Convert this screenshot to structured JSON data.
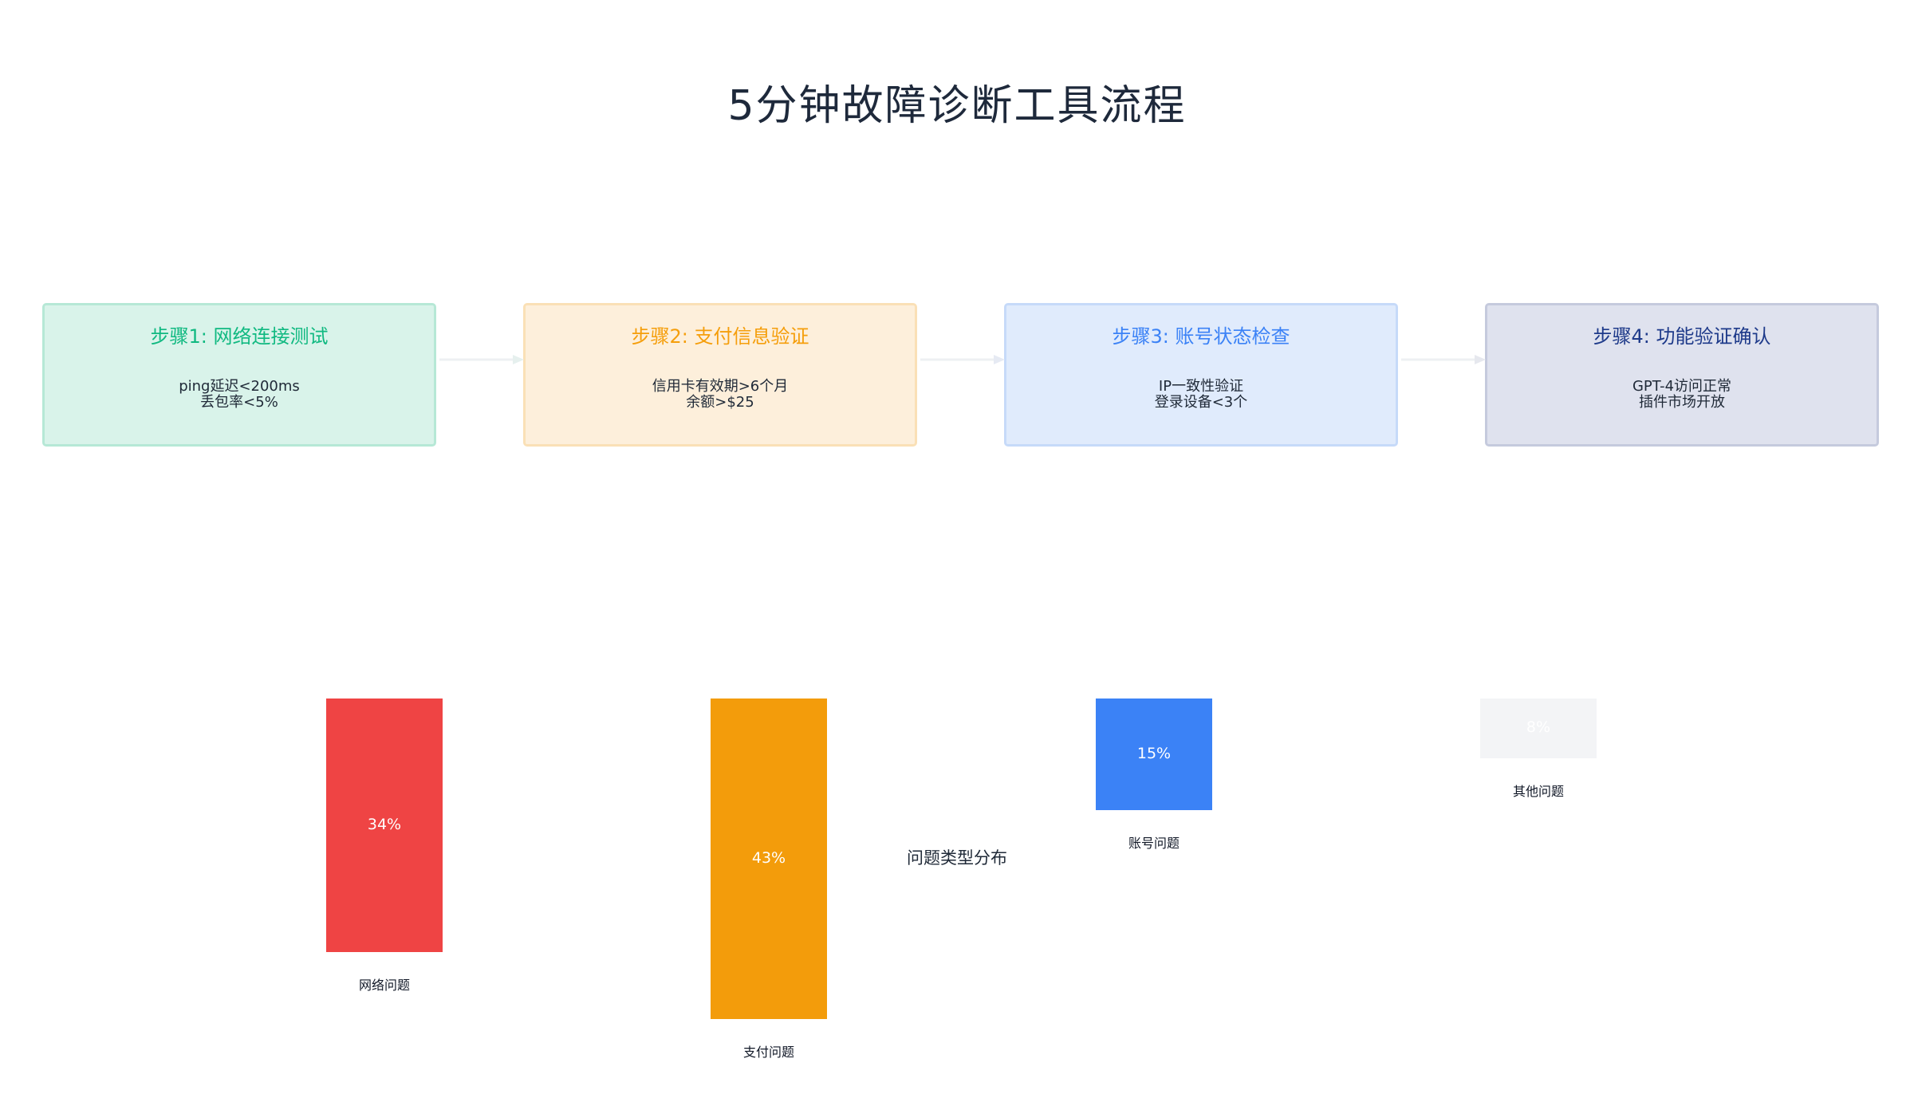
{
  "title": "5分钟故障诊断工具流程",
  "steps": [
    {
      "title": "步骤1: 网络连接测试",
      "lines": [
        "ping延迟<200ms",
        "丢包率<5%"
      ],
      "color": "#10b981",
      "bg": "#d9f3ea",
      "border": "#b6e8d6"
    },
    {
      "title": "步骤2: 支付信息验证",
      "lines": [
        "信用卡有效期>6个月",
        "余额>$25"
      ],
      "color": "#f59e0b",
      "bg": "#fdefdb",
      "border": "#fae0b6"
    },
    {
      "title": "步骤3: 账号状态检查",
      "lines": [
        "IP一致性验证",
        "登录设备<3个"
      ],
      "color": "#3b82f6",
      "bg": "#e0ebfc",
      "border": "#c6daf9"
    },
    {
      "title": "步骤4: 功能验证确认",
      "lines": [
        "GPT-4访问正常",
        "插件市场开放"
      ],
      "color": "#1e3a8a",
      "bg": "#dfe2ee",
      "border": "#c5cadd"
    }
  ],
  "chart_data": {
    "type": "bar",
    "title": "问题类型分布",
    "categories": [
      "网络问题",
      "支付问题",
      "账号问题",
      "其他问题"
    ],
    "values": [
      34,
      43,
      15,
      8
    ],
    "value_labels": [
      "34%",
      "43%",
      "15%",
      "8%"
    ],
    "colors": [
      "#ef4444",
      "#f39c0b",
      "#3b82f6",
      "#f3f4f6"
    ]
  }
}
